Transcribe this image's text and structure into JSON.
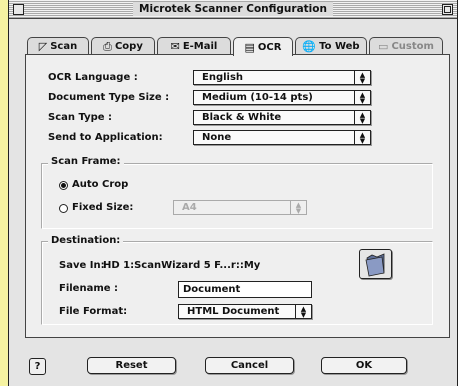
{
  "window": {
    "title": "Microtek Scanner Configuration"
  },
  "tabs": [
    {
      "label": "Scan",
      "icon": "scan-icon",
      "glyph": "◸"
    },
    {
      "label": "Copy",
      "icon": "copy-icon",
      "glyph": "⎙"
    },
    {
      "label": "E-Mail",
      "icon": "email-icon",
      "glyph": "✉"
    },
    {
      "label": "OCR",
      "icon": "ocr-icon",
      "glyph": "▤"
    },
    {
      "label": "To Web",
      "icon": "web-icon",
      "glyph": "🌐"
    },
    {
      "label": "Custom",
      "icon": "custom-icon",
      "glyph": "▭"
    }
  ],
  "active_tab": "OCR",
  "ocr": {
    "language_label": "OCR Language :",
    "language_value": "English",
    "doc_type_label": "Document Type Size :",
    "doc_type_value": "Medium (10-14 pts)",
    "scan_type_label": "Scan Type :",
    "scan_type_value": "Black & White",
    "send_label": "Send to Application:",
    "send_value": "None"
  },
  "scan_frame": {
    "title": "Scan Frame:",
    "auto_crop_label": "Auto Crop",
    "fixed_size_label": "Fixed Size:",
    "fixed_size_value": "A4",
    "selected": "auto_crop"
  },
  "destination": {
    "title": "Destination:",
    "save_in_label": "Save In:",
    "save_in_value": "HD 1:ScanWizard 5 F...r::My",
    "filename_label": "Filename :",
    "filename_value": "Document",
    "format_label": "File Format:",
    "format_value": "HTML Document"
  },
  "buttons": {
    "help": "?",
    "reset": "Reset",
    "cancel": "Cancel",
    "ok": "OK"
  },
  "colors": {
    "desktop": "#f6f3a2",
    "window": "#e4e4e4",
    "panel": "#efefef",
    "folder": "#7a8ab0"
  }
}
